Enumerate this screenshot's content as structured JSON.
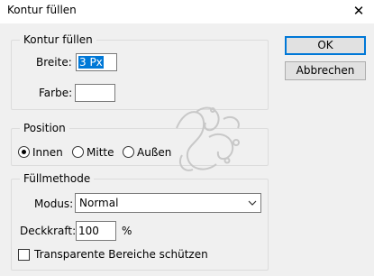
{
  "window": {
    "title": "Kontur füllen",
    "close_glyph": "✕"
  },
  "stroke_group": {
    "legend": "Kontur füllen",
    "width_label": "Breite:",
    "width_value": "3 Px",
    "color_label": "Farbe:",
    "color_swatch": "#ffffff"
  },
  "buttons": {
    "ok": "OK",
    "cancel": "Abbrechen"
  },
  "position_group": {
    "legend": "Position",
    "options": [
      "Innen",
      "Mitte",
      "Außen"
    ],
    "selected": "Innen"
  },
  "blend_group": {
    "legend": "Füllmethode",
    "mode_label": "Modus:",
    "mode_value": "Normal",
    "opacity_label": "Deckkraft:",
    "opacity_value": "100",
    "opacity_unit": "%",
    "preserve_transparency_label": "Transparente Bereiche schützen",
    "preserve_transparency_checked": false
  },
  "icons": {
    "close": "close-icon",
    "dropdown": "chevron-down-icon",
    "watermark": "decorative-swirl-watermark"
  }
}
